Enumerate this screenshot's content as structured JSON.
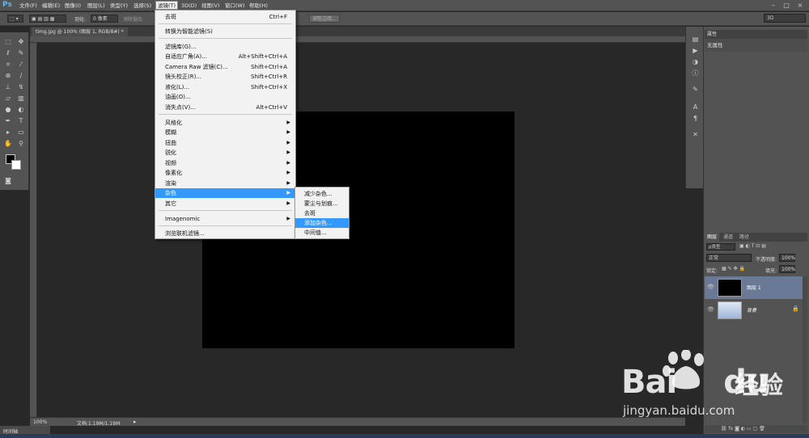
{
  "app": {
    "logo": "Ps"
  },
  "menubar": {
    "items": [
      "文件(F)",
      "编辑(E)",
      "图像(I)",
      "图层(L)",
      "类型(Y)",
      "选择(S)",
      "滤镜(T)",
      "3D(D)",
      "视图(V)",
      "窗口(W)",
      "帮助(H)"
    ]
  },
  "options_bar": {
    "feather_label": "羽化:",
    "feather_value": "0 像素",
    "antialias_label": "消除锯齿",
    "refine_button": "调整边缘...",
    "workspace": "3D"
  },
  "document": {
    "tab_title": "timg.jpg @ 100% (图层 1, RGB/8#) *",
    "zoom": "100%",
    "doc_info": "文档:1.19M/1.19M",
    "canvas_color": "#000000"
  },
  "timeline_tab": "时间轴",
  "filter_menu": {
    "items": [
      {
        "label": "去斑",
        "shortcut": "Ctrl+F"
      },
      {
        "label": "转换为智能滤镜(S)",
        "shortcut": ""
      },
      {
        "label": "滤镜库(G)...",
        "shortcut": ""
      },
      {
        "label": "自适应广角(A)...",
        "shortcut": "Alt+Shift+Ctrl+A"
      },
      {
        "label": "Camera Raw 滤镜(C)...",
        "shortcut": "Shift+Ctrl+A"
      },
      {
        "label": "镜头校正(R)...",
        "shortcut": "Shift+Ctrl+R"
      },
      {
        "label": "液化(L)...",
        "shortcut": "Shift+Ctrl+X"
      },
      {
        "label": "油画(O)...",
        "shortcut": ""
      },
      {
        "label": "消失点(V)...",
        "shortcut": "Alt+Ctrl+V"
      },
      {
        "label": "风格化",
        "shortcut": ""
      },
      {
        "label": "模糊",
        "shortcut": ""
      },
      {
        "label": "扭曲",
        "shortcut": ""
      },
      {
        "label": "锐化",
        "shortcut": ""
      },
      {
        "label": "视频",
        "shortcut": ""
      },
      {
        "label": "像素化",
        "shortcut": ""
      },
      {
        "label": "渲染",
        "shortcut": ""
      },
      {
        "label": "杂色",
        "shortcut": ""
      },
      {
        "label": "其它",
        "shortcut": ""
      },
      {
        "label": "Imagenomic",
        "shortcut": ""
      },
      {
        "label": "浏览联机滤镜...",
        "shortcut": ""
      }
    ],
    "highlighted": "杂色"
  },
  "noise_submenu": {
    "items": [
      "减少杂色...",
      "蒙尘与划痕...",
      "去斑",
      "添加杂色...",
      "中间值..."
    ],
    "highlighted": "添加杂色..."
  },
  "properties_panel": {
    "title": "属性",
    "body": "无属性"
  },
  "layers_panel": {
    "tabs": [
      "图层",
      "通道",
      "路径"
    ],
    "filter_kind": "ρ类型",
    "blend_mode": "正常",
    "opacity_label": "不透明度:",
    "opacity_value": "100%",
    "lock_label": "锁定:",
    "fill_label": "填充:",
    "fill_value": "100%",
    "layers": [
      {
        "name": "图层 1",
        "selected": true,
        "thumb_color": "#000000"
      },
      {
        "name": "背景",
        "selected": false,
        "thumb_color": "#b8c8e0"
      }
    ]
  },
  "watermark": {
    "brand_latin": "Bai",
    "brand_paw_char": "du",
    "brand_cn": "经验",
    "url": "jingyan.baidu.com"
  },
  "colors": {
    "highlight": "#3399ff",
    "menu_bg": "#f2f2f2",
    "ui_gray": "#535353",
    "selected_layer": "#6a7a96"
  }
}
